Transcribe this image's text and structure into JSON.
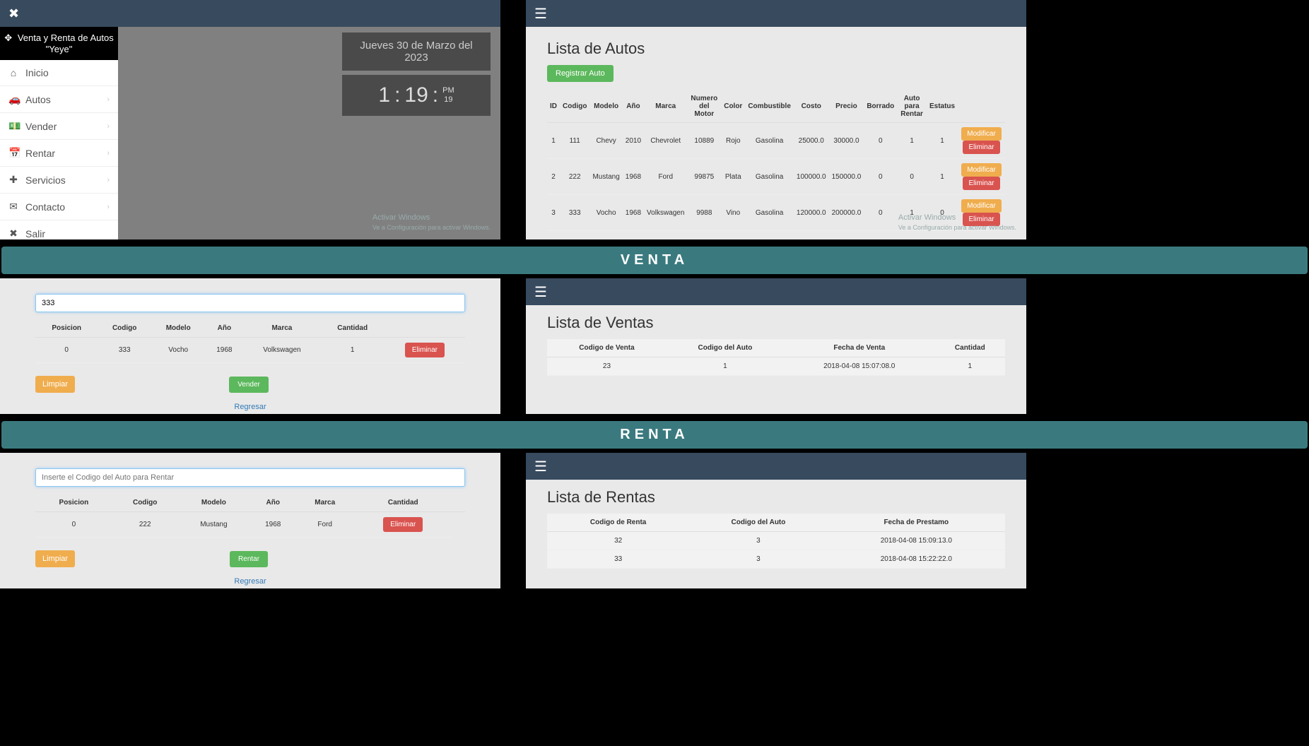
{
  "brand": {
    "name": "Venta y Renta de Autos",
    "sub": "\"Yeye\""
  },
  "sidebar": {
    "items": [
      {
        "icon": "⌂",
        "label": "Inicio",
        "chev": false
      },
      {
        "icon": "🚗",
        "label": "Autos",
        "chev": true
      },
      {
        "icon": "💵",
        "label": "Vender",
        "chev": true
      },
      {
        "icon": "📅",
        "label": "Rentar",
        "chev": true
      },
      {
        "icon": "✚",
        "label": "Servicios",
        "chev": true
      },
      {
        "icon": "✉",
        "label": "Contacto",
        "chev": true
      },
      {
        "icon": "✖",
        "label": "Salir",
        "chev": false
      }
    ]
  },
  "dashboard": {
    "date": "Jueves 30 de Marzo del 2023",
    "time_h": "1",
    "time_m": "19",
    "time_ampm": "PM",
    "time_s": "19"
  },
  "watermark": {
    "title": "Activar Windows",
    "sub": "Ve a Configuración para activar Windows."
  },
  "autos": {
    "title": "Lista de Autos",
    "register_btn": "Registrar Auto",
    "modify_btn": "Modificar",
    "delete_btn": "Eliminar",
    "headers": [
      "ID",
      "Codigo",
      "Modelo",
      "Año",
      "Marca",
      "Numero del Motor",
      "Color",
      "Combustible",
      "Costo",
      "Precio",
      "Borrado",
      "Auto para Rentar",
      "Estatus"
    ],
    "rows": [
      [
        "1",
        "111",
        "Chevy",
        "2010",
        "Chevrolet",
        "10889",
        "Rojo",
        "Gasolina",
        "25000.0",
        "30000.0",
        "0",
        "1",
        "1"
      ],
      [
        "2",
        "222",
        "Mustang",
        "1968",
        "Ford",
        "99875",
        "Plata",
        "Gasolina",
        "100000.0",
        "150000.0",
        "0",
        "0",
        "1"
      ],
      [
        "3",
        "333",
        "Vocho",
        "1968",
        "Volkswagen",
        "9988",
        "Vino",
        "Gasolina",
        "120000.0",
        "200000.0",
        "0",
        "1",
        "0"
      ]
    ]
  },
  "banners": {
    "venta": "VENTA",
    "renta": "RENTA"
  },
  "venta_form": {
    "input_value": "333",
    "headers": [
      "Posicion",
      "Codigo",
      "Modelo",
      "Año",
      "Marca",
      "Cantidad"
    ],
    "row": [
      "0",
      "333",
      "Vocho",
      "1968",
      "Volkswagen",
      "1"
    ],
    "delete_btn": "Eliminar",
    "clear_btn": "Limpiar",
    "action_btn": "Vender",
    "back_link": "Regresar"
  },
  "ventas_list": {
    "title": "Lista de Ventas",
    "headers": [
      "Codigo de Venta",
      "Codigo del Auto",
      "Fecha de Venta",
      "Cantidad"
    ],
    "rows": [
      [
        "23",
        "1",
        "2018-04-08 15:07:08.0",
        "1"
      ]
    ]
  },
  "renta_form": {
    "placeholder": "Inserte el Codigo del Auto para Rentar",
    "headers": [
      "Posicion",
      "Codigo",
      "Modelo",
      "Año",
      "Marca",
      "Cantidad"
    ],
    "row": [
      "0",
      "222",
      "Mustang",
      "1968",
      "Ford"
    ],
    "delete_btn": "Eliminar",
    "clear_btn": "Limpiar",
    "action_btn": "Rentar",
    "back_link": "Regresar"
  },
  "rentas_list": {
    "title": "Lista de Rentas",
    "headers": [
      "Codigo de Renta",
      "Codigo del Auto",
      "Fecha de Prestamo"
    ],
    "rows": [
      [
        "32",
        "3",
        "2018-04-08 15:09:13.0"
      ],
      [
        "33",
        "3",
        "2018-04-08 15:22:22.0"
      ]
    ]
  }
}
